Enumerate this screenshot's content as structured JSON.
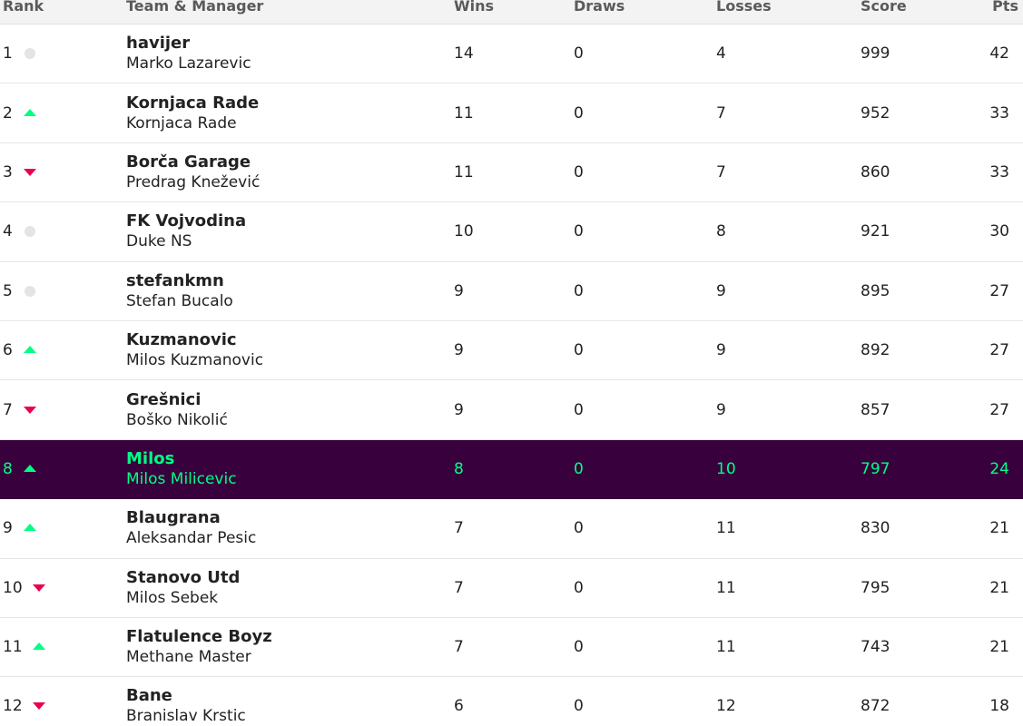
{
  "headers": {
    "rank": "Rank",
    "team_manager": "Team & Manager",
    "wins": "Wins",
    "draws": "Draws",
    "losses": "Losses",
    "score": "Score",
    "pts": "Pts"
  },
  "colors": {
    "highlight_bg": "#38003c",
    "highlight_text": "#00ff85",
    "move_up": "#00ff85",
    "move_down": "#e90052",
    "move_same": "#e4e4e4"
  },
  "rows": [
    {
      "rank": "1",
      "move": "same",
      "team": "havijer",
      "manager": "Marko Lazarevic",
      "wins": "14",
      "draws": "0",
      "losses": "4",
      "score": "999",
      "pts": "42",
      "highlight": false
    },
    {
      "rank": "2",
      "move": "up",
      "team": "Kornjaca Rade",
      "manager": "Kornjaca Rade",
      "wins": "11",
      "draws": "0",
      "losses": "7",
      "score": "952",
      "pts": "33",
      "highlight": false
    },
    {
      "rank": "3",
      "move": "down",
      "team": "Borča Garage",
      "manager": "Predrag Knežević",
      "wins": "11",
      "draws": "0",
      "losses": "7",
      "score": "860",
      "pts": "33",
      "highlight": false
    },
    {
      "rank": "4",
      "move": "same",
      "team": "FK Vojvodina",
      "manager": "Duke NS",
      "wins": "10",
      "draws": "0",
      "losses": "8",
      "score": "921",
      "pts": "30",
      "highlight": false
    },
    {
      "rank": "5",
      "move": "same",
      "team": "stefankmn",
      "manager": "Stefan Bucalo",
      "wins": "9",
      "draws": "0",
      "losses": "9",
      "score": "895",
      "pts": "27",
      "highlight": false
    },
    {
      "rank": "6",
      "move": "up",
      "team": "Kuzmanovic",
      "manager": "Milos Kuzmanovic",
      "wins": "9",
      "draws": "0",
      "losses": "9",
      "score": "892",
      "pts": "27",
      "highlight": false
    },
    {
      "rank": "7",
      "move": "down",
      "team": "Grešnici",
      "manager": "Boško Nikolić",
      "wins": "9",
      "draws": "0",
      "losses": "9",
      "score": "857",
      "pts": "27",
      "highlight": false
    },
    {
      "rank": "8",
      "move": "up",
      "team": "Milos",
      "manager": "Milos Milicevic",
      "wins": "8",
      "draws": "0",
      "losses": "10",
      "score": "797",
      "pts": "24",
      "highlight": true
    },
    {
      "rank": "9",
      "move": "up",
      "team": "Blaugrana",
      "manager": "Aleksandar Pesic",
      "wins": "7",
      "draws": "0",
      "losses": "11",
      "score": "830",
      "pts": "21",
      "highlight": false
    },
    {
      "rank": "10",
      "move": "down",
      "team": "Stanovo Utd",
      "manager": "Milos Sebek",
      "wins": "7",
      "draws": "0",
      "losses": "11",
      "score": "795",
      "pts": "21",
      "highlight": false
    },
    {
      "rank": "11",
      "move": "up",
      "team": "Flatulence Boyz",
      "manager": "Methane Master",
      "wins": "7",
      "draws": "0",
      "losses": "11",
      "score": "743",
      "pts": "21",
      "highlight": false
    },
    {
      "rank": "12",
      "move": "down",
      "team": "Bane",
      "manager": "Branislav Krstic",
      "wins": "6",
      "draws": "0",
      "losses": "12",
      "score": "872",
      "pts": "18",
      "highlight": false
    }
  ]
}
